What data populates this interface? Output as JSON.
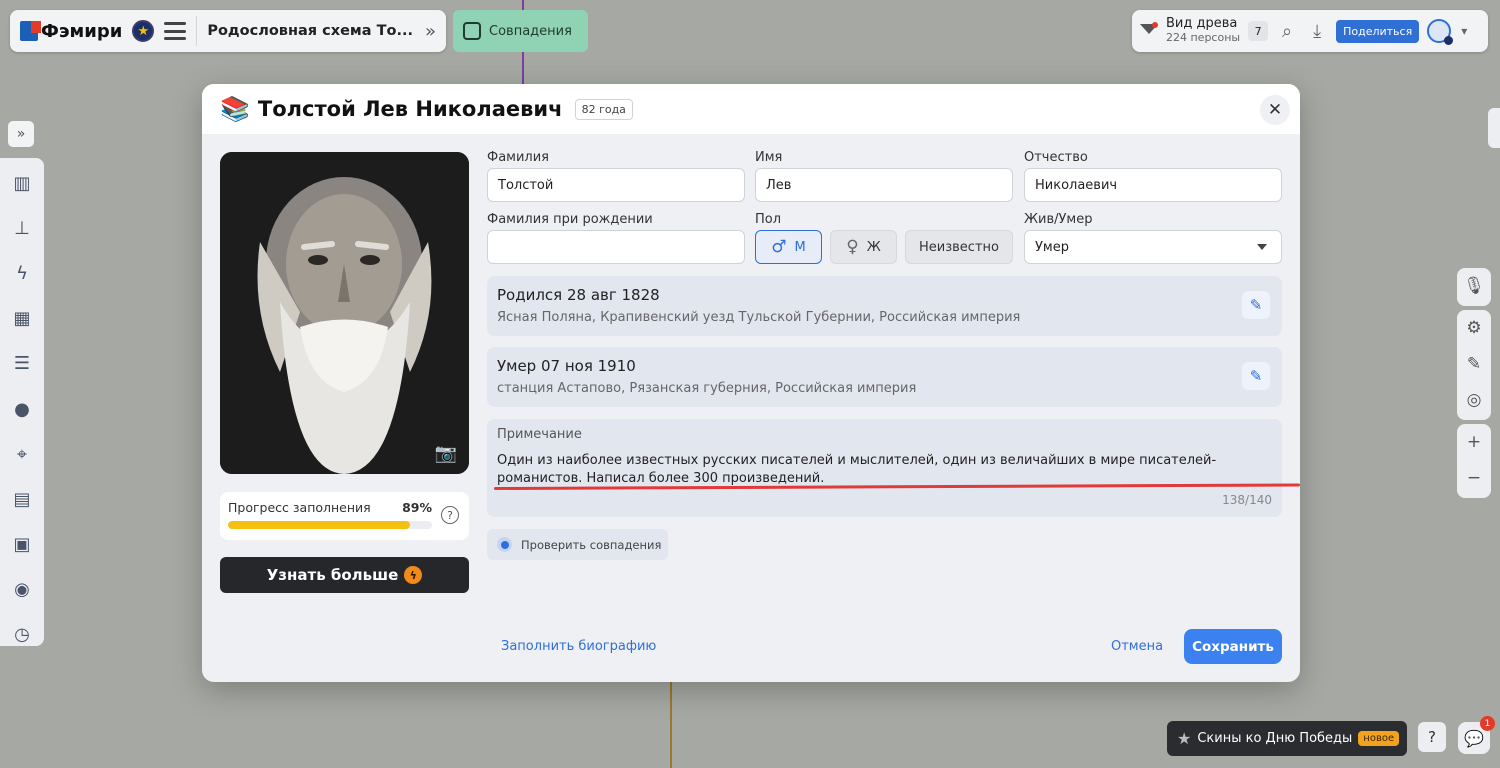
{
  "app": {
    "logo_text": "Фэмири",
    "tree_title": "Родословная схема То...",
    "matches_tab": "Совпадения"
  },
  "toolbar": {
    "view_title": "Вид древа",
    "people_count": "224 персоны",
    "badge": "7",
    "share_label": "Поделиться"
  },
  "person": {
    "name": "Толстой Лев Николаевич",
    "age": "82 года"
  },
  "form": {
    "surname_label": "Фамилия",
    "surname": "Толстой",
    "name_label": "Имя",
    "name": "Лев",
    "patronymic_label": "Отчество",
    "patronymic": "Николаевич",
    "birth_surname_label": "Фамилия при рождении",
    "birth_surname": "",
    "gender_label": "Пол",
    "gender_male": "М",
    "gender_female": "Ж",
    "gender_unknown": "Неизвестно",
    "alive_label": "Жив/Умер",
    "alive_value": "Умер"
  },
  "birth": {
    "title": "Родился 28 авг 1828",
    "place": "Ясная Поляна, Крапивенский уезд Тульской Губернии, Российская империя"
  },
  "death": {
    "title": "Умер 07 ноя 1910",
    "place": "станция Астапово, Рязанская губерния, Российская империя"
  },
  "note": {
    "label": "Примечание",
    "text": "Один из наиболее известных русских писателей и мыслителей, один из величайших в мире писателей-романистов. Написал более 300 произведений.",
    "counter": "138/140"
  },
  "progress": {
    "label": "Прогресс заполнения",
    "value": "89%",
    "fraction": 0.89
  },
  "actions": {
    "learn_more": "Узнать больше",
    "check_matches": "Проверить совпадения",
    "fill_bio": "Заполнить биографию",
    "cancel": "Отмена",
    "save": "Сохранить"
  },
  "promo": {
    "text": "Скины ко Дню Победы",
    "badge": "новое"
  },
  "notifications": "1",
  "colors": {
    "accent": "#3b82f0",
    "progress": "#f5c110",
    "matches_tab": "#8fd2b4",
    "annotation_line": "#e03a3a"
  }
}
